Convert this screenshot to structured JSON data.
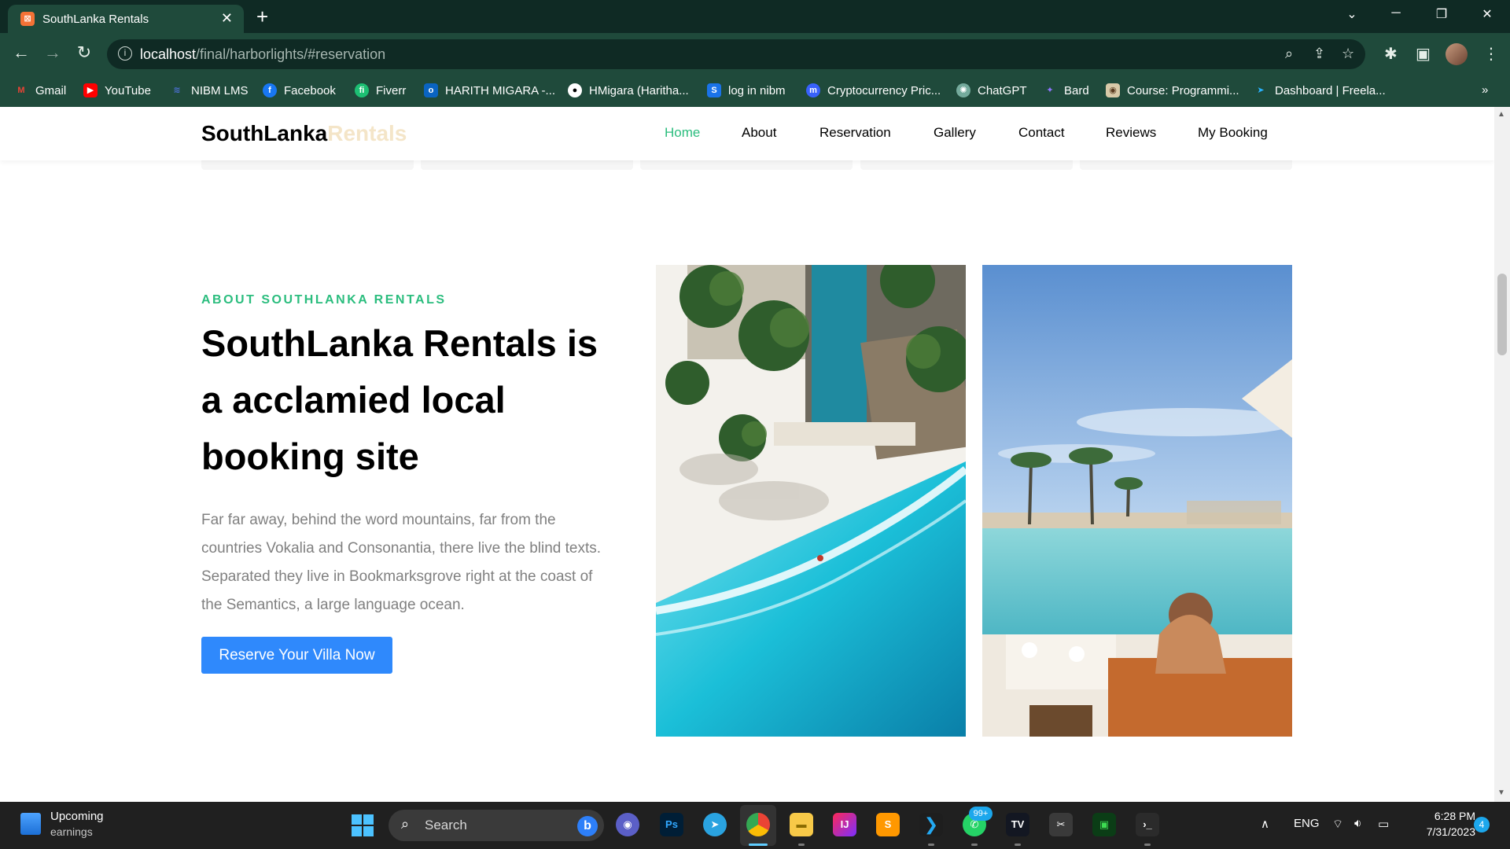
{
  "browser": {
    "tab_title": "SouthLanka Rentals",
    "tab_favicon": "xampp-icon",
    "url_host": "localhost",
    "url_path": "/final/harborlights/#reservation",
    "bookmarks": [
      {
        "label": "Gmail",
        "icon": "gmail-icon",
        "color": "#ea4335"
      },
      {
        "label": "YouTube",
        "icon": "youtube-icon",
        "color": "#ff0000"
      },
      {
        "label": "NIBM LMS",
        "icon": "nibm-icon",
        "color": "#2a4d9b"
      },
      {
        "label": "Facebook",
        "icon": "facebook-icon",
        "color": "#1877f2"
      },
      {
        "label": "Fiverr",
        "icon": "fiverr-icon",
        "color": "#1dbf73"
      },
      {
        "label": "HARITH MIGARA -...",
        "icon": "outlook-icon",
        "color": "#0a64c2"
      },
      {
        "label": "HMigara (Haritha...",
        "icon": "github-icon",
        "color": "#ffffff"
      },
      {
        "label": "log in nibm",
        "icon": "s-icon",
        "color": "#1a73e8"
      },
      {
        "label": "Cryptocurrency Pric...",
        "icon": "coinmarketcap-icon",
        "color": "#3861fb"
      },
      {
        "label": "ChatGPT",
        "icon": "chatgpt-icon",
        "color": "#74aa9c"
      },
      {
        "label": "Bard",
        "icon": "bard-icon",
        "color": "#8e75ff"
      },
      {
        "label": "Course: Programmi...",
        "icon": "course-icon",
        "color": "#d8c9a8"
      },
      {
        "label": "Dashboard | Freela...",
        "icon": "freelancer-icon",
        "color": "#29b2fe"
      }
    ],
    "more_bookmarks": "»"
  },
  "site": {
    "logo_main": "SouthLanka",
    "logo_accent": "Rentals",
    "nav": [
      {
        "label": "Home",
        "active": true
      },
      {
        "label": "About",
        "active": false
      },
      {
        "label": "Reservation",
        "active": false
      },
      {
        "label": "Gallery",
        "active": false
      },
      {
        "label": "Contact",
        "active": false
      },
      {
        "label": "Reviews",
        "active": false
      },
      {
        "label": "My Booking",
        "active": false
      }
    ],
    "about": {
      "eyebrow": "ABOUT SOUTHLANKA RENTALS",
      "headline": "SouthLanka Rentals is a acclamied local booking site",
      "paragraph": "Far far away, behind the word mountains, far from the countries Vokalia and Consonantia, there live the blind texts. Separated they live in Bookmarksgrove right at the coast of the Semantics, a large language ocean.",
      "cta": "Reserve Your Villa Now"
    },
    "colors": {
      "accent": "#2bbd7e",
      "button": "#2f89fc",
      "logo_accent": "#f4e5c8"
    }
  },
  "taskbar": {
    "weather_line1": "Upcoming",
    "weather_line2": "earnings",
    "search_label": "Search",
    "whatsapp_badge": "99+",
    "tray_lang": "ENG",
    "time": "6:28 PM",
    "date": "7/31/2023",
    "notification_count": "4"
  }
}
